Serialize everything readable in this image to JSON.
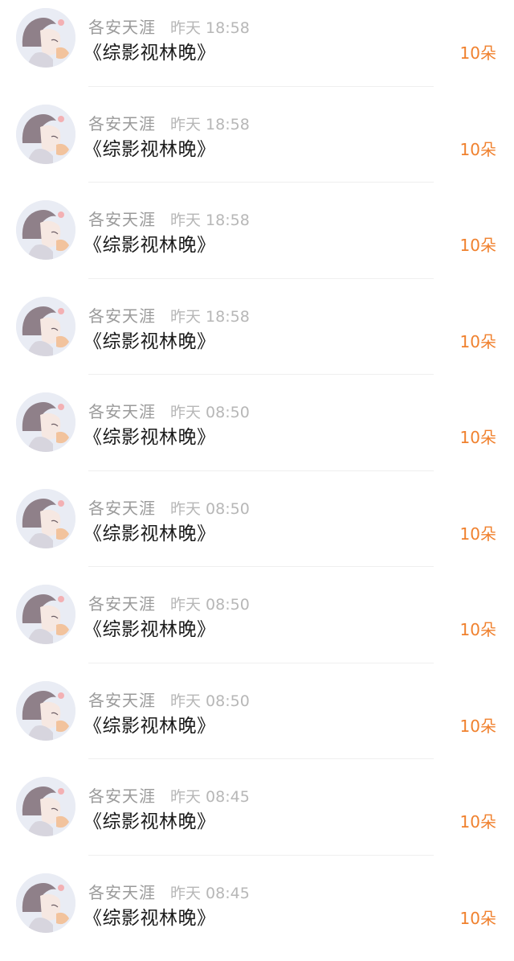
{
  "rows": [
    {
      "name": "各安天涯",
      "time": "昨天 18:58",
      "title": "《综影视林晚》",
      "amount": "10朵",
      "avatar": "avatar-image"
    },
    {
      "name": "各安天涯",
      "time": "昨天 18:58",
      "title": "《综影视林晚》",
      "amount": "10朵",
      "avatar": "avatar-image"
    },
    {
      "name": "各安天涯",
      "time": "昨天 18:58",
      "title": "《综影视林晚》",
      "amount": "10朵",
      "avatar": "avatar-image"
    },
    {
      "name": "各安天涯",
      "time": "昨天 18:58",
      "title": "《综影视林晚》",
      "amount": "10朵",
      "avatar": "avatar-image"
    },
    {
      "name": "各安天涯",
      "time": "昨天 08:50",
      "title": "《综影视林晚》",
      "amount": "10朵",
      "avatar": "avatar-image"
    },
    {
      "name": "各安天涯",
      "time": "昨天 08:50",
      "title": "《综影视林晚》",
      "amount": "10朵",
      "avatar": "avatar-image"
    },
    {
      "name": "各安天涯",
      "time": "昨天 08:50",
      "title": "《综影视林晚》",
      "amount": "10朵",
      "avatar": "avatar-image"
    },
    {
      "name": "各安天涯",
      "time": "昨天 08:50",
      "title": "《综影视林晚》",
      "amount": "10朵",
      "avatar": "avatar-image"
    },
    {
      "name": "各安天涯",
      "time": "昨天 08:45",
      "title": "《综影视林晚》",
      "amount": "10朵",
      "avatar": "avatar-image"
    },
    {
      "name": "各安天涯",
      "time": "昨天 08:45",
      "title": "《综影视林晚》",
      "amount": "10朵",
      "avatar": "avatar-image"
    }
  ],
  "colors": {
    "amount": "#f0812e",
    "name": "#9a9a9a",
    "time": "#b7b7b7",
    "title": "#1a1a1a",
    "divider": "#efefef"
  }
}
